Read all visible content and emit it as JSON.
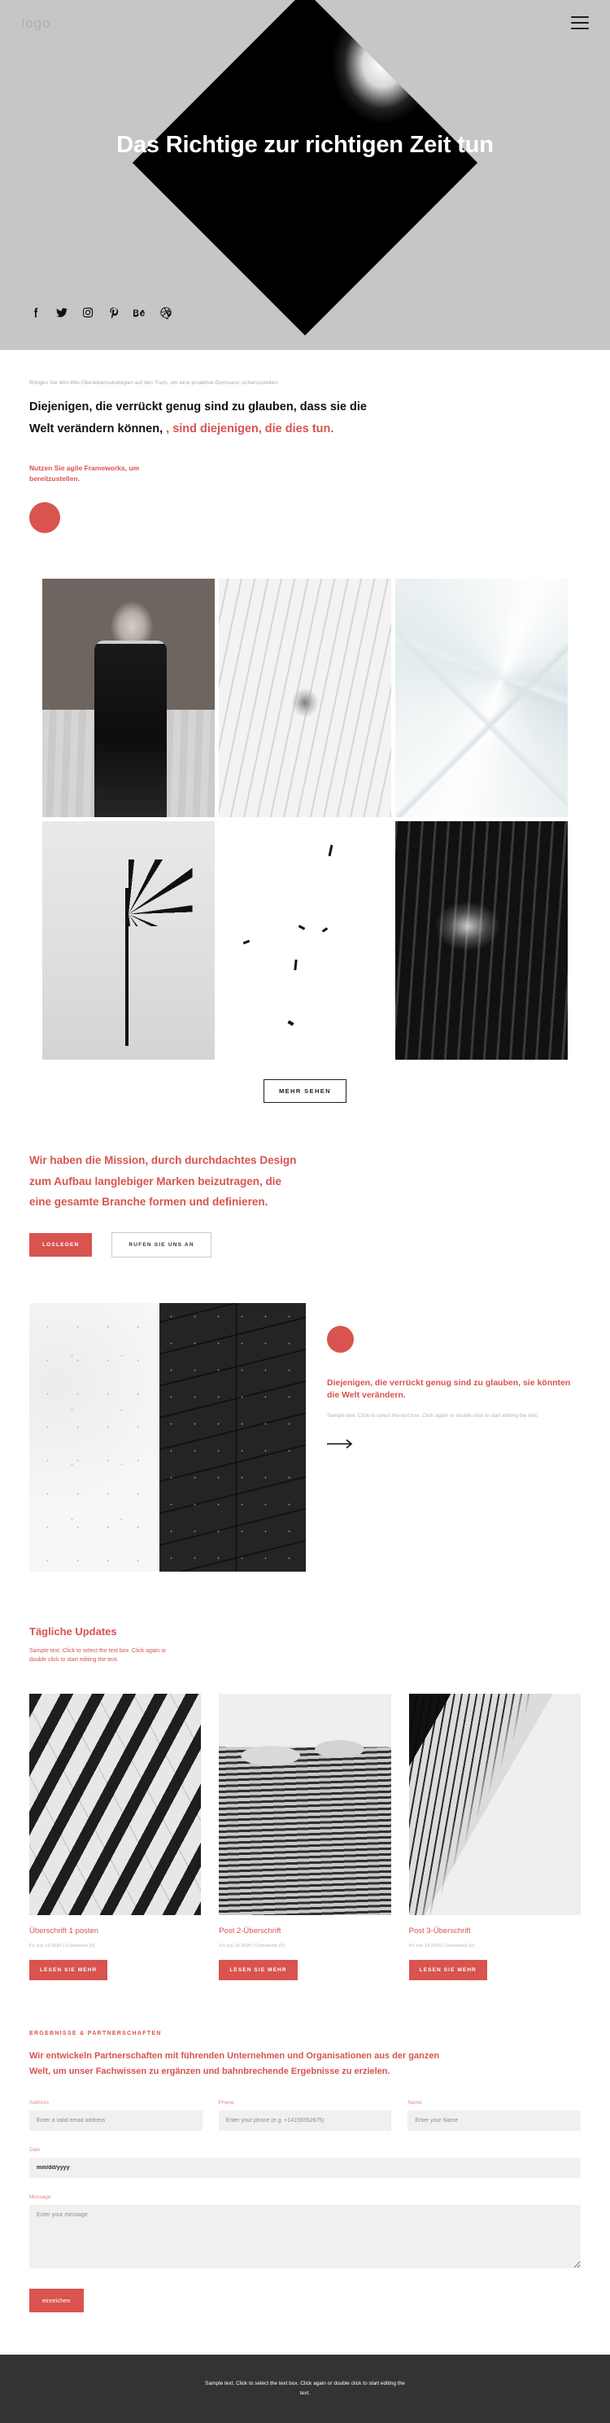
{
  "header": {
    "logo": "logo",
    "menu_icon": "hamburger-icon"
  },
  "hero": {
    "title": "Das Richtige zur richtigen Zeit tun",
    "social": [
      {
        "name": "facebook-icon",
        "label": "Facebook"
      },
      {
        "name": "twitter-icon",
        "label": "Twitter"
      },
      {
        "name": "instagram-icon",
        "label": "Instagram"
      },
      {
        "name": "pinterest-icon",
        "label": "Pinterest"
      },
      {
        "name": "behance-icon",
        "label": "Behance"
      },
      {
        "name": "dribbble-icon",
        "label": "Dribbble"
      }
    ]
  },
  "intro": {
    "eyebrow": "Bringen Sie Win-Win-Überlebensstrategien auf den Tisch, um eine proaktive Dominanz sicherzustellen.",
    "quote_black": "Diejenigen, die verrückt genug sind zu glauben, dass sie die Welt verändern können, ",
    "quote_red": ", sind diejenigen, die dies tun.",
    "subnote": "Nutzen Sie agile Frameworks, um bereitzustellen."
  },
  "gallery": {
    "items": [
      {
        "name": "gallery-image-woman-beach",
        "style": "ph-woman"
      },
      {
        "name": "gallery-image-white-tunnel",
        "style": "ph-tunnel"
      },
      {
        "name": "gallery-image-white-polygons",
        "style": "ph-poly"
      },
      {
        "name": "gallery-image-palm-tree",
        "style": "ph-palm"
      },
      {
        "name": "gallery-image-minimal-marks",
        "style": "ph-min"
      },
      {
        "name": "gallery-image-face-hand",
        "style": "ph-face"
      }
    ],
    "more_button": "Mehr sehen"
  },
  "mission": {
    "heading": "Wir haben die Mission, durch durchdachtes Design zum Aufbau langlebiger Marken beizutragen, die eine gesamte Branche formen und definieren.",
    "primary_button": "Loslegen",
    "secondary_button": "Rufen Sie uns an"
  },
  "split": {
    "heading": "Diejenigen, die verrückt genug sind zu glauben, sie könnten die Welt verändern.",
    "body": "Sample text. Click to select the text box. Click again or double click to start editing the text.",
    "arrow_icon": "arrow-right-icon"
  },
  "updates": {
    "heading": "Tägliche Updates",
    "subtext": "Sample text. Click to select the text box. Click again or double click to start editing the text.",
    "posts": [
      {
        "title": "Überschrift 1 posten",
        "meta": "Fri Jun 19 2020  |  Comments (0)",
        "button": "Lesen Sie mehr",
        "image_name": "post-image-zebra-stairs",
        "image_style": "ci-zebra"
      },
      {
        "title": "Post 2-Überschrift",
        "meta": "Fri Jun 19 2020  |  Comments (0)",
        "button": "Lesen Sie mehr",
        "image_name": "post-image-wavy-facade",
        "image_style": "ci-wave"
      },
      {
        "title": "Post 3-Überschrift",
        "meta": "Fri Jun 19 2020  |  Comments (0)",
        "button": "Lesen Sie mehr",
        "image_name": "post-image-skyscrapers",
        "image_style": "ci-sky"
      }
    ]
  },
  "contact": {
    "kicker": "Ergebnisse & Partnerschaften",
    "heading": "Wir entwickeln Partnerschaften mit führenden Unternehmen und Organisationen aus der ganzen Welt, um unser Fachwissen zu ergänzen und bahnbrechende Ergebnisse zu erzielen.",
    "fields": {
      "address_label": "Address",
      "address_placeholder": "Enter a valid email address",
      "phone_label": "Phone",
      "phone_placeholder": "Enter your phone (e.g. +14155552675)",
      "name_label": "Name",
      "name_placeholder": "Enter your Name",
      "date_label": "Date",
      "date_value": "mm/dd/yyyy",
      "message_label": "Message",
      "message_placeholder": "Enter your message"
    },
    "submit_button": "einreichen"
  },
  "footer": {
    "text": "Sample text. Click to select the text box. Click again or double click to start editing the text."
  },
  "colors": {
    "accent": "#d9534f",
    "hero_bg": "#c6c6c6",
    "footer_bg": "#333333",
    "input_bg": "#f0f0f0"
  }
}
